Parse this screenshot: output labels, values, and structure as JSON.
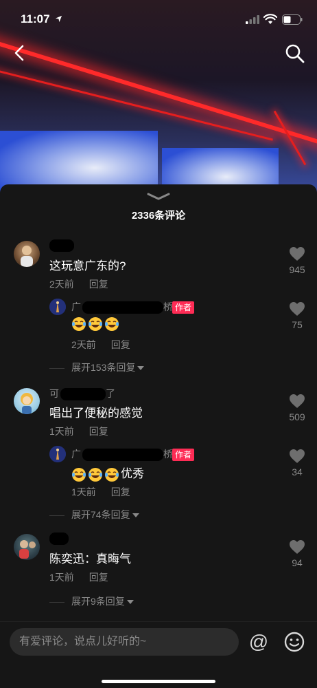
{
  "status_bar": {
    "time": "11:07"
  },
  "comments_header": {
    "count_text": "2336条评论"
  },
  "comments": [
    {
      "text": "这玩意广东的?",
      "time": "2天前",
      "reply_label": "回复",
      "likes": "945",
      "reply": {
        "prefix": "广",
        "suffix": "桥",
        "badge": "作者",
        "text": "",
        "time": "2天前",
        "reply_label": "回复",
        "likes": "75"
      },
      "expand": "展开153条回复"
    },
    {
      "name_prefix": "可",
      "name_suffix": "了",
      "text": "唱出了便秘的感觉",
      "time": "1天前",
      "reply_label": "回复",
      "likes": "509",
      "reply": {
        "prefix": "广",
        "suffix": "桥",
        "badge": "作者",
        "text": "优秀",
        "time": "1天前",
        "reply_label": "回复",
        "likes": "34"
      },
      "expand": "展开74条回复"
    },
    {
      "text": "陈奕迅：真晦气",
      "time": "1天前",
      "reply_label": "回复",
      "likes": "94",
      "expand": "展开9条回复"
    }
  ],
  "input_bar": {
    "placeholder": "有爱评论，说点儿好听的~",
    "at_symbol": "@"
  },
  "colors": {
    "accent": "#fe2c55",
    "background": "#161616",
    "muted_text": "#8a8a8a"
  },
  "icons": [
    "location-arrow-icon",
    "signal-icon",
    "wifi-icon",
    "battery-icon",
    "back-icon",
    "search-icon",
    "chevron-down-icon",
    "heart-icon",
    "laugh-cry-emoji-icon",
    "smiley-icon"
  ]
}
